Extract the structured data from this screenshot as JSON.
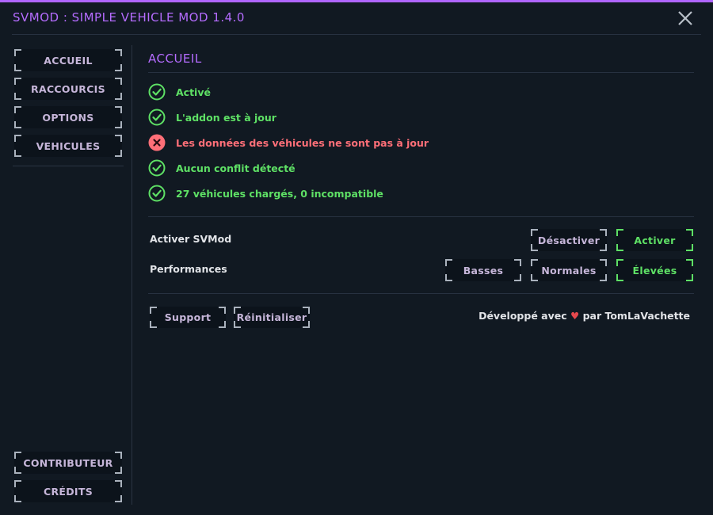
{
  "window": {
    "title": "SVMOD : SIMPLE VEHICLE MOD 1.4.0",
    "accent": "#b56cff",
    "close_icon": "close-icon"
  },
  "sidebar": {
    "items": [
      {
        "label": "ACCUEIL"
      },
      {
        "label": "RACCOURCIS"
      },
      {
        "label": "OPTIONS"
      },
      {
        "label": "VEHICULES"
      }
    ],
    "bottom_items": [
      {
        "label": "CONTRIBUTEUR"
      },
      {
        "label": "CRÉDITS"
      }
    ]
  },
  "main": {
    "section_title": "ACCUEIL",
    "statuses": [
      {
        "text": "Activé",
        "state": "ok"
      },
      {
        "text": "L'addon est à jour",
        "state": "ok"
      },
      {
        "text": "Les données des véhicules ne sont pas à jour",
        "state": "error"
      },
      {
        "text": "Aucun conflit détecté",
        "state": "ok"
      },
      {
        "text": "27 véhicules chargés, 0 incompatible",
        "state": "ok"
      }
    ],
    "settings": {
      "enable_label": "Activer SVMod",
      "enable_options": [
        "Désactiver",
        "Activer"
      ],
      "enable_selected": "Activer",
      "performance_label": "Performances",
      "performance_options": [
        "Basses",
        "Normales",
        "Élevées"
      ],
      "performance_selected": "Élevées"
    },
    "actions": {
      "support_label": "Support",
      "reset_label": "Réinitialiser"
    },
    "credit": {
      "prefix": "Développé avec",
      "heart": "♥",
      "suffix": "par TomLaVachette"
    }
  },
  "colors": {
    "ok": "#5ee065",
    "error": "#ff6f78",
    "heart": "#e5484d",
    "background": "#111922"
  }
}
